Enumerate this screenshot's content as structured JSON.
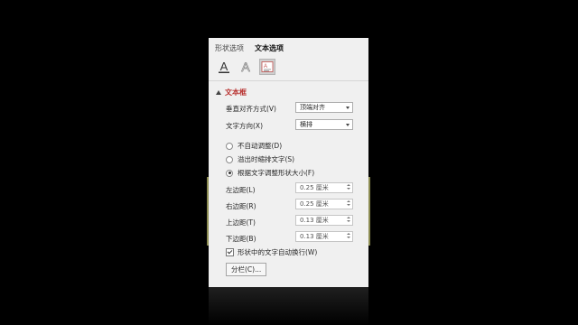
{
  "tabs": [
    "形状选项",
    "文本选项"
  ],
  "icons": [
    "text-fill-icon",
    "text-outline-icon",
    "textbox-icon"
  ],
  "section": {
    "title": "文本框"
  },
  "vertical_align": {
    "label": "垂直对齐方式(V)",
    "value": "顶端对齐"
  },
  "text_direction": {
    "label": "文字方向(X)",
    "value": "横排"
  },
  "autofit": {
    "options": [
      "不自动调整(D)",
      "溢出时缩排文字(S)",
      "根据文字调整形状大小(F)"
    ],
    "selected": 2
  },
  "margins": {
    "left": {
      "label": "左边距(L)",
      "value": "0.25 厘米"
    },
    "right": {
      "label": "右边距(R)",
      "value": "0.25 厘米"
    },
    "top": {
      "label": "上边距(T)",
      "value": "0.13 厘米"
    },
    "bottom": {
      "label": "下边距(B)",
      "value": "0.13 厘米"
    }
  },
  "wrap": {
    "label": "形状中的文字自动换行(W)",
    "checked": true
  },
  "columns_button": "分栏(C)...",
  "colors": {
    "accent": "#b8312f",
    "highlight": "#ffff96",
    "panel": "#f0f0f0"
  }
}
